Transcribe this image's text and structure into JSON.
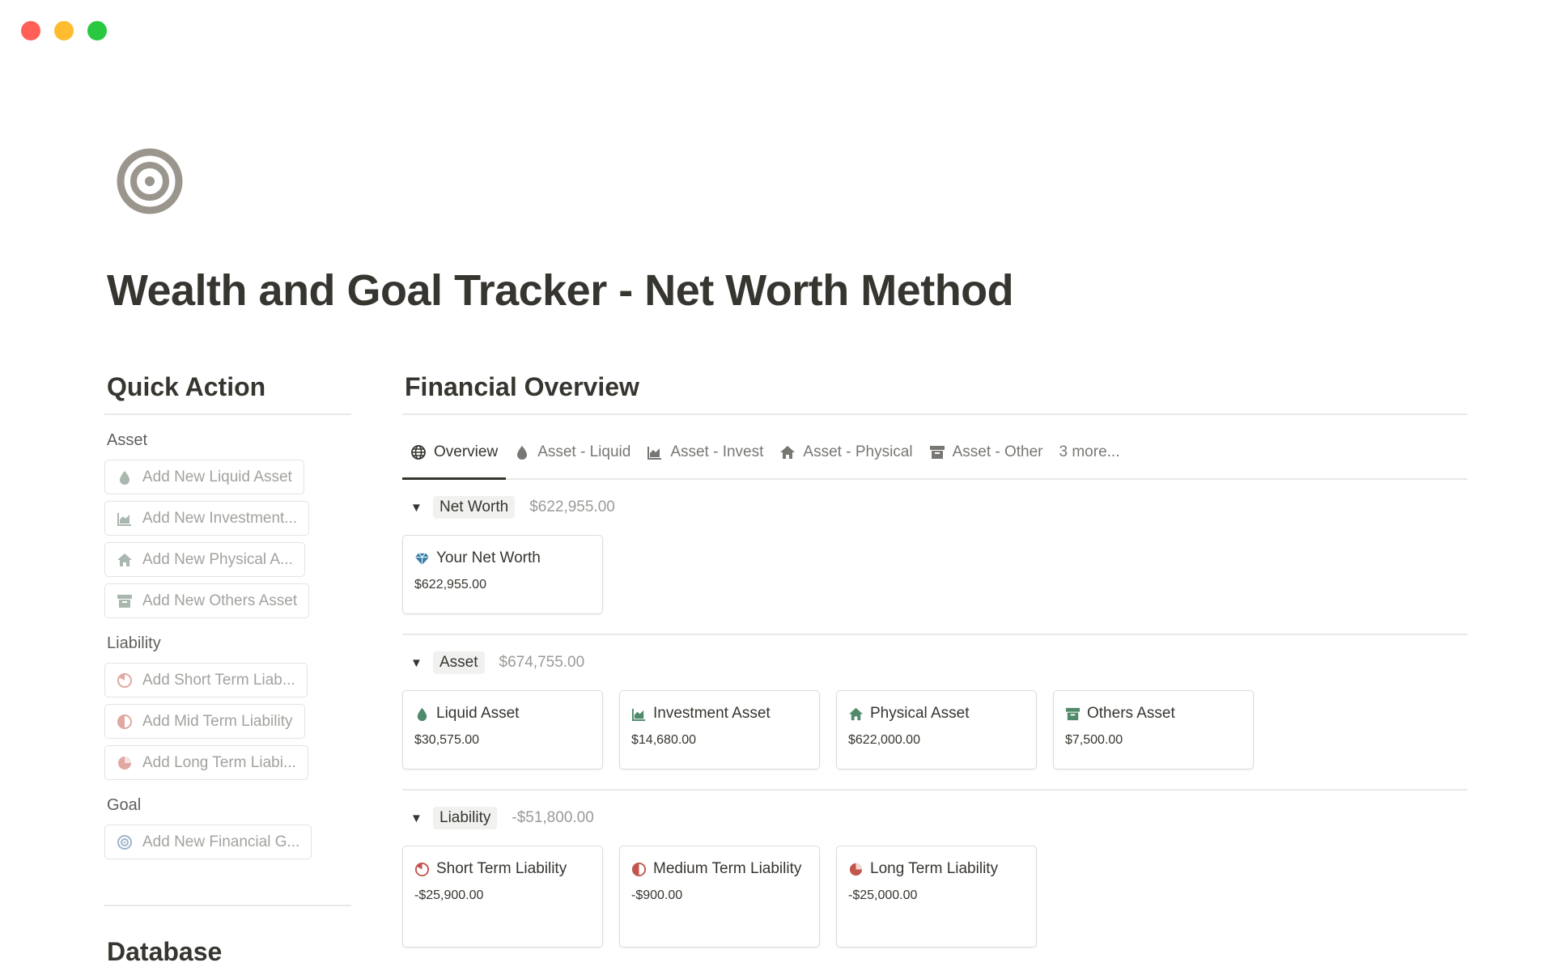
{
  "page": {
    "title": "Wealth and Goal Tracker - Net Worth Method"
  },
  "quick_action": {
    "heading": "Quick Action",
    "asset_label": "Asset",
    "asset_buttons": [
      "Add New Liquid Asset",
      "Add New Investment...",
      "Add New Physical A...",
      "Add New Others Asset"
    ],
    "liability_label": "Liability",
    "liability_buttons": [
      "Add Short Term Liab...",
      "Add Mid Term Liability",
      "Add Long Term Liabi..."
    ],
    "goal_label": "Goal",
    "goal_buttons": [
      "Add New Financial G..."
    ]
  },
  "database": {
    "heading": "Database"
  },
  "overview": {
    "heading": "Financial Overview",
    "tabs": [
      "Overview",
      "Asset - Liquid",
      "Asset - Invest",
      "Asset - Physical",
      "Asset - Other",
      "3 more..."
    ],
    "groups": [
      {
        "label": "Net Worth",
        "total": "$622,955.00",
        "cards": [
          {
            "title": "Your Net Worth",
            "value": "$622,955.00"
          }
        ]
      },
      {
        "label": "Asset",
        "total": "$674,755.00",
        "cards": [
          {
            "title": "Liquid Asset",
            "value": "$30,575.00"
          },
          {
            "title": "Investment Asset",
            "value": "$14,680.00"
          },
          {
            "title": "Physical Asset",
            "value": "$622,000.00"
          },
          {
            "title": "Others Asset",
            "value": "$7,500.00"
          }
        ]
      },
      {
        "label": "Liability",
        "total": "-$51,800.00",
        "cards": [
          {
            "title": "Short Term Liability",
            "value": "-$25,900.00"
          },
          {
            "title": "Medium Term Liability",
            "value": "-$900.00"
          },
          {
            "title": "Long Term Liability",
            "value": "-$25,000.00"
          }
        ]
      }
    ]
  },
  "colors": {
    "green_icon": "#4f8a6b",
    "red_icon": "#c4554d",
    "blue_icon": "#337ea9",
    "muted_icon": "#a9b7ae",
    "muted_red_icon": "#e0a8a3"
  }
}
